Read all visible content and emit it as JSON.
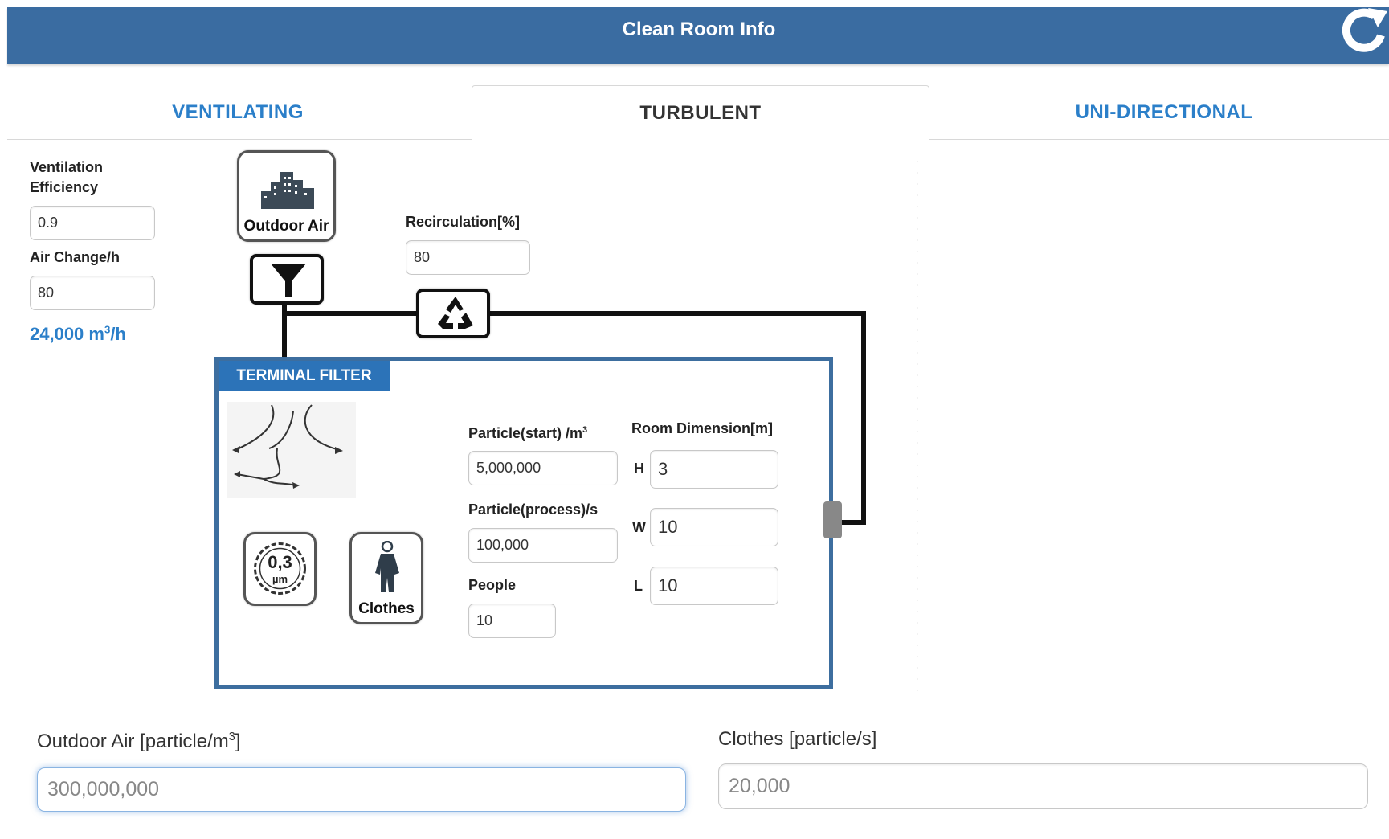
{
  "header": {
    "title": "Clean Room Info",
    "refresh_icon": "refresh-icon"
  },
  "tabs": [
    {
      "label": "VENTILATING",
      "active": false
    },
    {
      "label": "TURBULENT",
      "active": true
    },
    {
      "label": "UNI-DIRECTIONAL",
      "active": false
    }
  ],
  "sidebar": {
    "ventilation_efficiency_label_1": "Ventilation",
    "ventilation_efficiency_label_2": "Efficiency",
    "ventilation_efficiency_value": "0.9",
    "air_change_label": "Air Change/h",
    "air_change_value": "80",
    "flow_value": "24,000 m",
    "flow_sup": "3",
    "flow_unit": "/h"
  },
  "diagram": {
    "outdoor_air_label": "Outdoor Air",
    "recirculation_label": "Recirculation[%]",
    "recirculation_value": "80",
    "terminal_filter_label": "TERMINAL FILTER",
    "particle_start_label": "Particle(start) /m",
    "particle_start_sup": "3",
    "particle_start_value": "5,000,000",
    "particle_process_label": "Particle(process)/s",
    "particle_process_value": "100,000",
    "people_label": "People",
    "people_value": "10",
    "room_dimension_label": "Room Dimension[m]",
    "h_label": "H",
    "h_value": "3",
    "w_label": "W",
    "w_value": "10",
    "l_label": "L",
    "l_value": "10",
    "particle_size_text": "0,3",
    "particle_size_unit": "µm",
    "clothes_label": "Clothes",
    "colors": {
      "header": "#3a6ca1",
      "link": "#2b7fc9",
      "room_border": "#3d6e9f",
      "badge": "#2c73b8"
    }
  },
  "bottom": {
    "outdoor_air_label": "Outdoor Air [particle/m",
    "outdoor_air_sup": "3",
    "outdoor_air_close": "]",
    "outdoor_air_placeholder": "300,000,000",
    "clothes_label": "Clothes [particle/s]",
    "clothes_placeholder": "20,000"
  }
}
